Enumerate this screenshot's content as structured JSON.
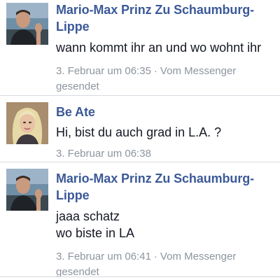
{
  "messages": [
    {
      "sender": "Mario-Max Prinz Zu Schaumburg-Lippe",
      "text_lines": [
        "wann kommt ihr an und wo wohnt ihr"
      ],
      "timestamp": "3. Februar um 06:35",
      "separator": "·",
      "source": "Vom Messenger gesendet",
      "avatar_icon": "profile-photo-man"
    },
    {
      "sender": "Be Ate",
      "text_lines": [
        "Hi, bist du auch grad in L.A. ?"
      ],
      "timestamp": "3. Februar um 06:38",
      "avatar_icon": "profile-photo-woman"
    },
    {
      "sender": "Mario-Max Prinz Zu Schaumburg-Lippe",
      "text_lines": [
        "jaaa schatz",
        "wo biste in LA"
      ],
      "timestamp": "3. Februar um 06:41",
      "separator": "·",
      "source": "Vom Messenger gesendet",
      "avatar_icon": "profile-photo-man"
    }
  ],
  "colors": {
    "name": "#3b5998",
    "text": "#141823",
    "meta": "#8d949e",
    "divider": "#d7dae0"
  }
}
